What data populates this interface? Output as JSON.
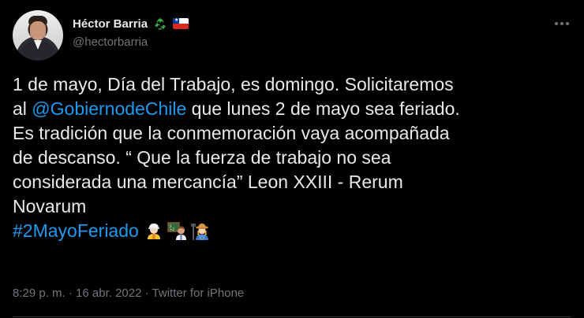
{
  "author": {
    "display_name": "Héctor Barria",
    "handle": "@hectorbarria",
    "badges": [
      "recycle-icon",
      "chile-flag-icon"
    ]
  },
  "tweet": {
    "lines": {
      "l1": "1 de mayo, Día del Trabajo, es domingo. Solicitaremos",
      "l2_pre": "al ",
      "l2_mention": "@GobiernodeChile",
      "l2_post": " que lunes 2 de mayo sea feriado.",
      "l3": "Es tradición que la conmemoración vaya acompañada",
      "l4": "de descanso. “ Que la fuerza de trabajo no sea",
      "l5": "considerada una mercancía” Leon XXIII - Rerum",
      "l6": "Novarum",
      "hashtag": "#2MayoFeriado"
    },
    "emojis": [
      "construction-worker-emoji",
      "teacher-emoji",
      "farmer-emoji"
    ]
  },
  "meta": {
    "time": "8:29 p. m.",
    "sep1": " · ",
    "date": "16 abr. 2022",
    "sep2": " · ",
    "source": "Twitter for iPhone"
  },
  "colors": {
    "background": "#000000",
    "text": "#e7e9ea",
    "secondary": "#71767b",
    "link": "#1d9bf0"
  }
}
